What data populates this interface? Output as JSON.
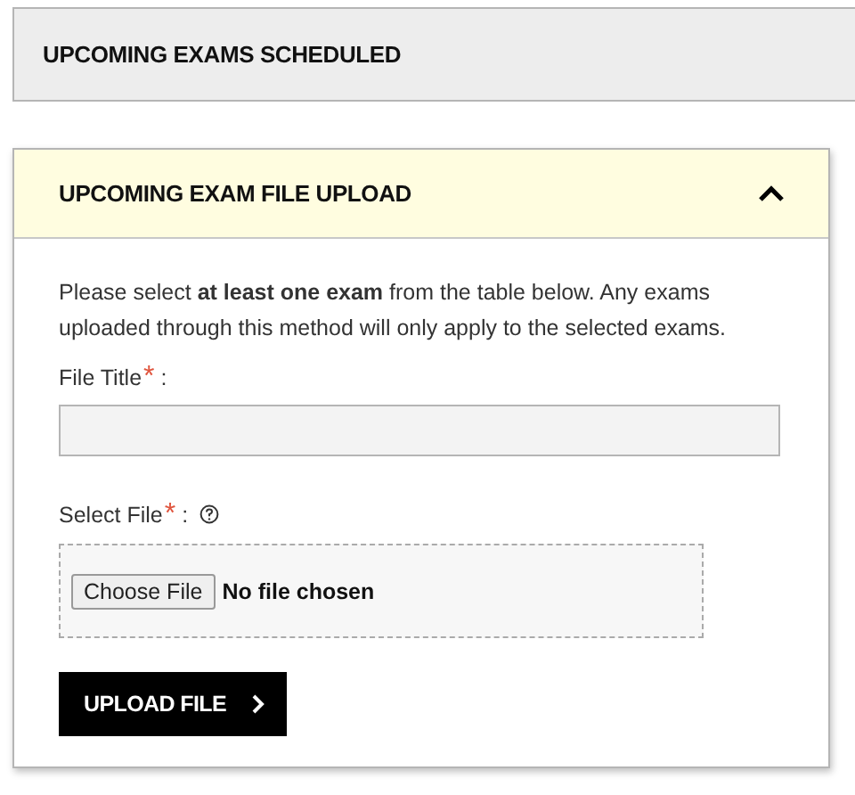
{
  "scheduled_panel": {
    "title": "UPCOMING EXAMS SCHEDULED"
  },
  "upload_panel": {
    "title": "UPCOMING EXAM FILE UPLOAD",
    "expanded": true,
    "instructions": "Please select **at least one exam** from the table below. Any exams uploaded through this method will only apply to the selected exams.",
    "fields": [
      {
        "kind": "text",
        "label": "File Title",
        "required_mark": "*",
        "suffix": ":"
      },
      {
        "kind": "file",
        "label": "Select File",
        "required_mark": "*",
        "suffix": ":",
        "help": true,
        "choose_button": "Choose File",
        "status": "No file chosen"
      }
    ],
    "submit_button": "UPLOAD FILE"
  }
}
